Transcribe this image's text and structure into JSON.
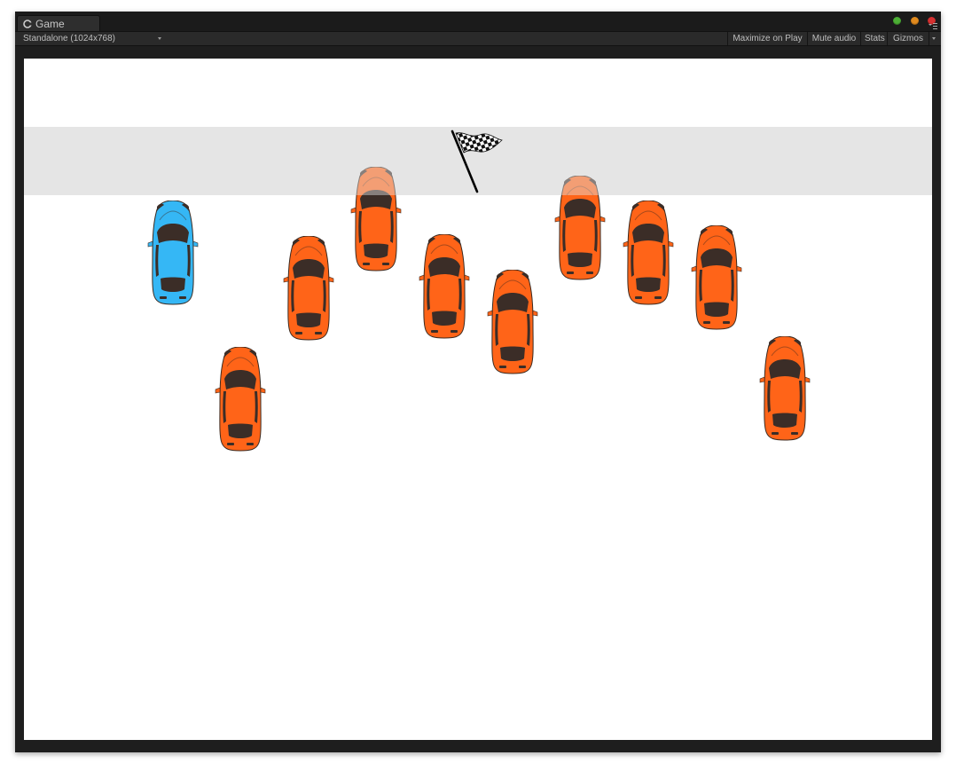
{
  "window": {
    "tab_label": "Game",
    "tab_icon": "unity-logo-icon",
    "buttons": [
      {
        "name": "maximize-window-button",
        "color": "#4caf35"
      },
      {
        "name": "minimize-window-button",
        "color": "#e08a1e"
      },
      {
        "name": "close-window-button",
        "color": "#d63030"
      }
    ]
  },
  "toolbar": {
    "resolution": "Standalone (1024x768)",
    "maximize_on_play": "Maximize on Play",
    "mute_audio": "Mute audio",
    "stats": "Stats",
    "gizmos": "Gizmos"
  },
  "game": {
    "background_color": "#ffffff",
    "finish_band_color": "#e5e5e5",
    "flag_icon": "checkered-flag-icon",
    "player_car": {
      "color": "#35b7f5"
    },
    "enemy_cars": {
      "color": "#ff6418",
      "count": 9
    }
  }
}
